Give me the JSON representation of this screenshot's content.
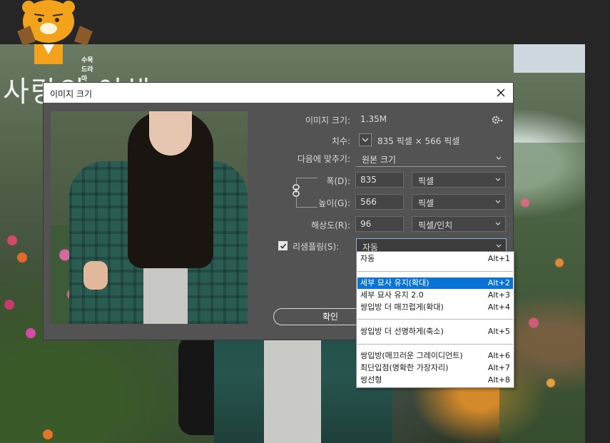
{
  "watermark": {
    "label": "수목드라마"
  },
  "background": {
    "title": "사랑의 이해"
  },
  "dialog": {
    "title": "이미지 크기",
    "image_size": {
      "label": "이미지 크기:",
      "value": "1.35M"
    },
    "dimensions": {
      "label": "치수:",
      "value": "835 픽셀  ×  566 픽셀"
    },
    "fit_to": {
      "label": "다음에 맞추기:",
      "value": "원본 크기"
    },
    "width": {
      "label": "폭(D):",
      "value": "835",
      "unit": "픽셀"
    },
    "height": {
      "label": "높이(G):",
      "value": "566",
      "unit": "픽셀"
    },
    "resolution": {
      "label": "해상도(R):",
      "value": "96",
      "unit": "픽셀/인치"
    },
    "resample": {
      "label": "리샘플링(S):",
      "value": "자동",
      "checked": true
    },
    "ok_label": "확인"
  },
  "resample_menu": {
    "items": [
      {
        "label": "자동",
        "shortcut": "Alt+1",
        "selected": false
      },
      {
        "label": "세부 묘사 유지(확대)",
        "shortcut": "Alt+2",
        "selected": true
      },
      {
        "label": "세부 묘사 유지 2.0",
        "shortcut": "Alt+3",
        "selected": false
      },
      {
        "label": "쌍입방 더 매끄럽게(확대)",
        "shortcut": "Alt+4",
        "selected": false
      },
      {
        "label": "쌍입방 더 선명하게(축소)",
        "shortcut": "Alt+5",
        "selected": false
      },
      {
        "label": "쌍입방(매끄러운 그레이디언트)",
        "shortcut": "Alt+6",
        "selected": false
      },
      {
        "label": "최단입점(명확한 가장자리)",
        "shortcut": "Alt+7",
        "selected": false
      },
      {
        "label": "쌍선형",
        "shortcut": "Alt+8",
        "selected": false
      }
    ]
  },
  "colors": {
    "dialog_bg": "#535353",
    "selection": "#0a74d6"
  }
}
